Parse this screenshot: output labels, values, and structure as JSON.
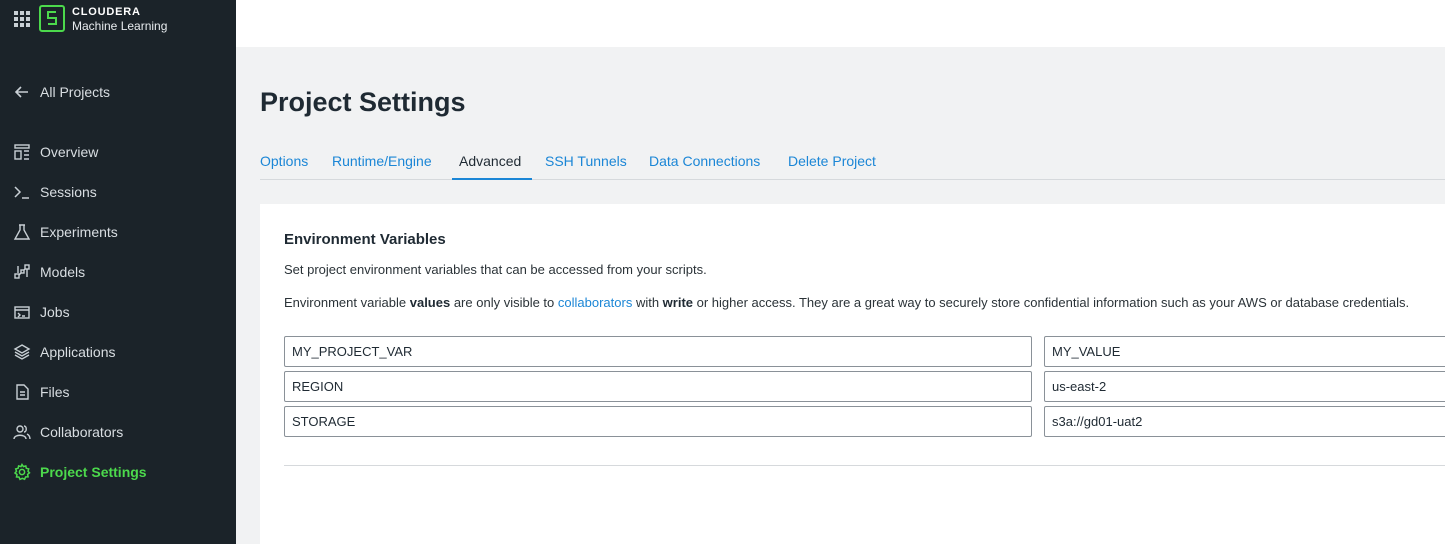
{
  "brand": {
    "name": "CLOUDERA",
    "subtitle": "Machine Learning",
    "accent_color": "#4cd94c"
  },
  "sidebar": {
    "back_label": "All Projects",
    "items": [
      {
        "label": "Overview",
        "icon": "overview-icon"
      },
      {
        "label": "Sessions",
        "icon": "terminal-icon"
      },
      {
        "label": "Experiments",
        "icon": "flask-icon"
      },
      {
        "label": "Models",
        "icon": "models-icon"
      },
      {
        "label": "Jobs",
        "icon": "jobs-icon"
      },
      {
        "label": "Applications",
        "icon": "layers-icon"
      },
      {
        "label": "Files",
        "icon": "file-icon"
      },
      {
        "label": "Collaborators",
        "icon": "users-icon"
      },
      {
        "label": "Project Settings",
        "icon": "gear-icon",
        "active": true
      }
    ]
  },
  "page": {
    "title": "Project Settings"
  },
  "tabs": [
    {
      "label": "Options"
    },
    {
      "label": "Runtime/Engine"
    },
    {
      "label": "Advanced",
      "active": true
    },
    {
      "label": "SSH Tunnels"
    },
    {
      "label": "Data Connections"
    },
    {
      "label": "Delete Project"
    }
  ],
  "env": {
    "title": "Environment Variables",
    "description": "Set project environment variables that can be accessed from your scripts.",
    "note": {
      "p1": "Environment variable ",
      "b1": "values",
      "p2": " are only visible to ",
      "link": "collaborators",
      "p3": " with ",
      "b2": "write",
      "p4": " or higher access. They are a great way to securely store confidential information such as your AWS or database credentials."
    },
    "rows": [
      {
        "key": "MY_PROJECT_VAR",
        "value": "MY_VALUE"
      },
      {
        "key": "REGION",
        "value": "us-east-2"
      },
      {
        "key": "STORAGE",
        "value": "s3a://gd01-uat2"
      }
    ]
  }
}
